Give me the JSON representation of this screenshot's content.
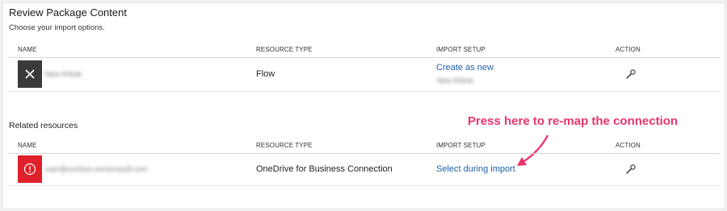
{
  "panel": {
    "title": "Review Package Content",
    "subtitle": "Choose your import options."
  },
  "columns": {
    "name": "NAME",
    "resource_type": "RESOURCE TYPE",
    "import_setup": "IMPORT SETUP",
    "action": "ACTION"
  },
  "package_row": {
    "name": "New Article",
    "resource_type": "Flow",
    "import_setup": "Create as new",
    "import_setup_detail": "New Article",
    "icon": "close-icon",
    "icon_color": "#3a3a3a"
  },
  "related": {
    "heading": "Related resources",
    "row": {
      "name": "user@contoso.onmicrosoft.com",
      "resource_type": "OneDrive for Business Connection",
      "import_setup": "Select during import",
      "icon": "alert-icon",
      "icon_color": "#e0202a"
    }
  },
  "annotation": {
    "text": "Press here to re-map the connection",
    "color": "#e8356d"
  }
}
